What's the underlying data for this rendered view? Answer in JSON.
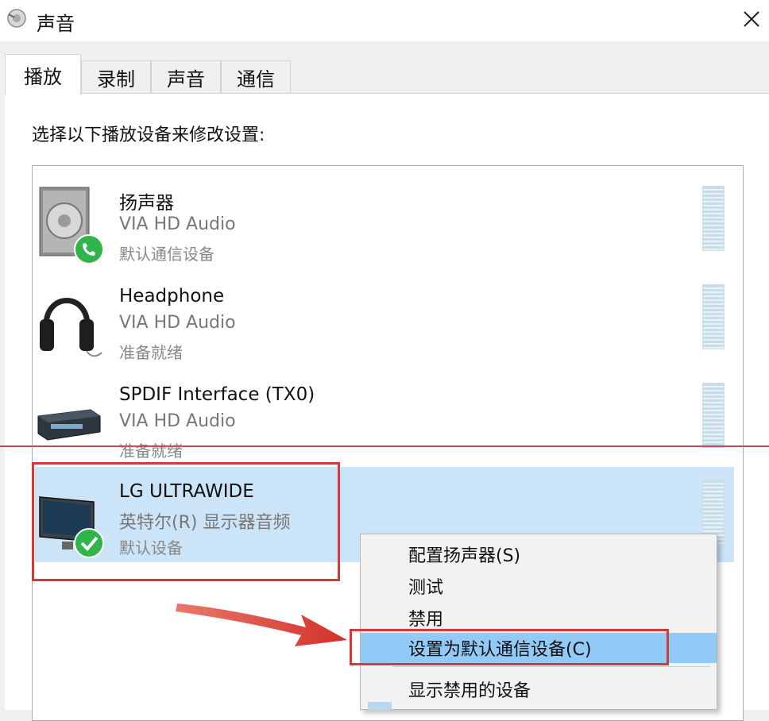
{
  "window": {
    "title": "声音"
  },
  "tabs": [
    {
      "label": "播放",
      "active": true
    },
    {
      "label": "录制",
      "active": false
    },
    {
      "label": "声音",
      "active": false
    },
    {
      "label": "通信",
      "active": false
    }
  ],
  "instruction": "选择以下播放设备来修改设置:",
  "devices": [
    {
      "name": "扬声器",
      "driver": "VIA HD Audio",
      "status": "默认通信设备",
      "icon": "speaker-icon",
      "badge": "phone-badge-icon"
    },
    {
      "name": "Headphone",
      "driver": "VIA HD Audio",
      "status": "准备就绪",
      "icon": "headphone-icon"
    },
    {
      "name": "SPDIF Interface (TX0)",
      "driver": "VIA HD Audio",
      "status": "准备就绪",
      "icon": "spdif-device-icon"
    },
    {
      "name": "LG ULTRAWIDE",
      "driver": "英特尔(R) 显示器音频",
      "status": "默认设备",
      "icon": "monitor-icon",
      "badge": "check-badge-icon",
      "selected": true
    }
  ],
  "context_menu": {
    "items": [
      {
        "label": "配置扬声器(S)"
      },
      {
        "label": "测试"
      },
      {
        "label": "禁用"
      },
      {
        "label": "设置为默认通信设备(C)",
        "hover": true
      },
      {
        "label": "显示禁用的设备"
      }
    ]
  },
  "colors": {
    "selected_row": "#cce4f7",
    "menu_hover": "#91c9f7",
    "annotation_red": "#d43a3a",
    "badge_green": "#2fb54a"
  }
}
